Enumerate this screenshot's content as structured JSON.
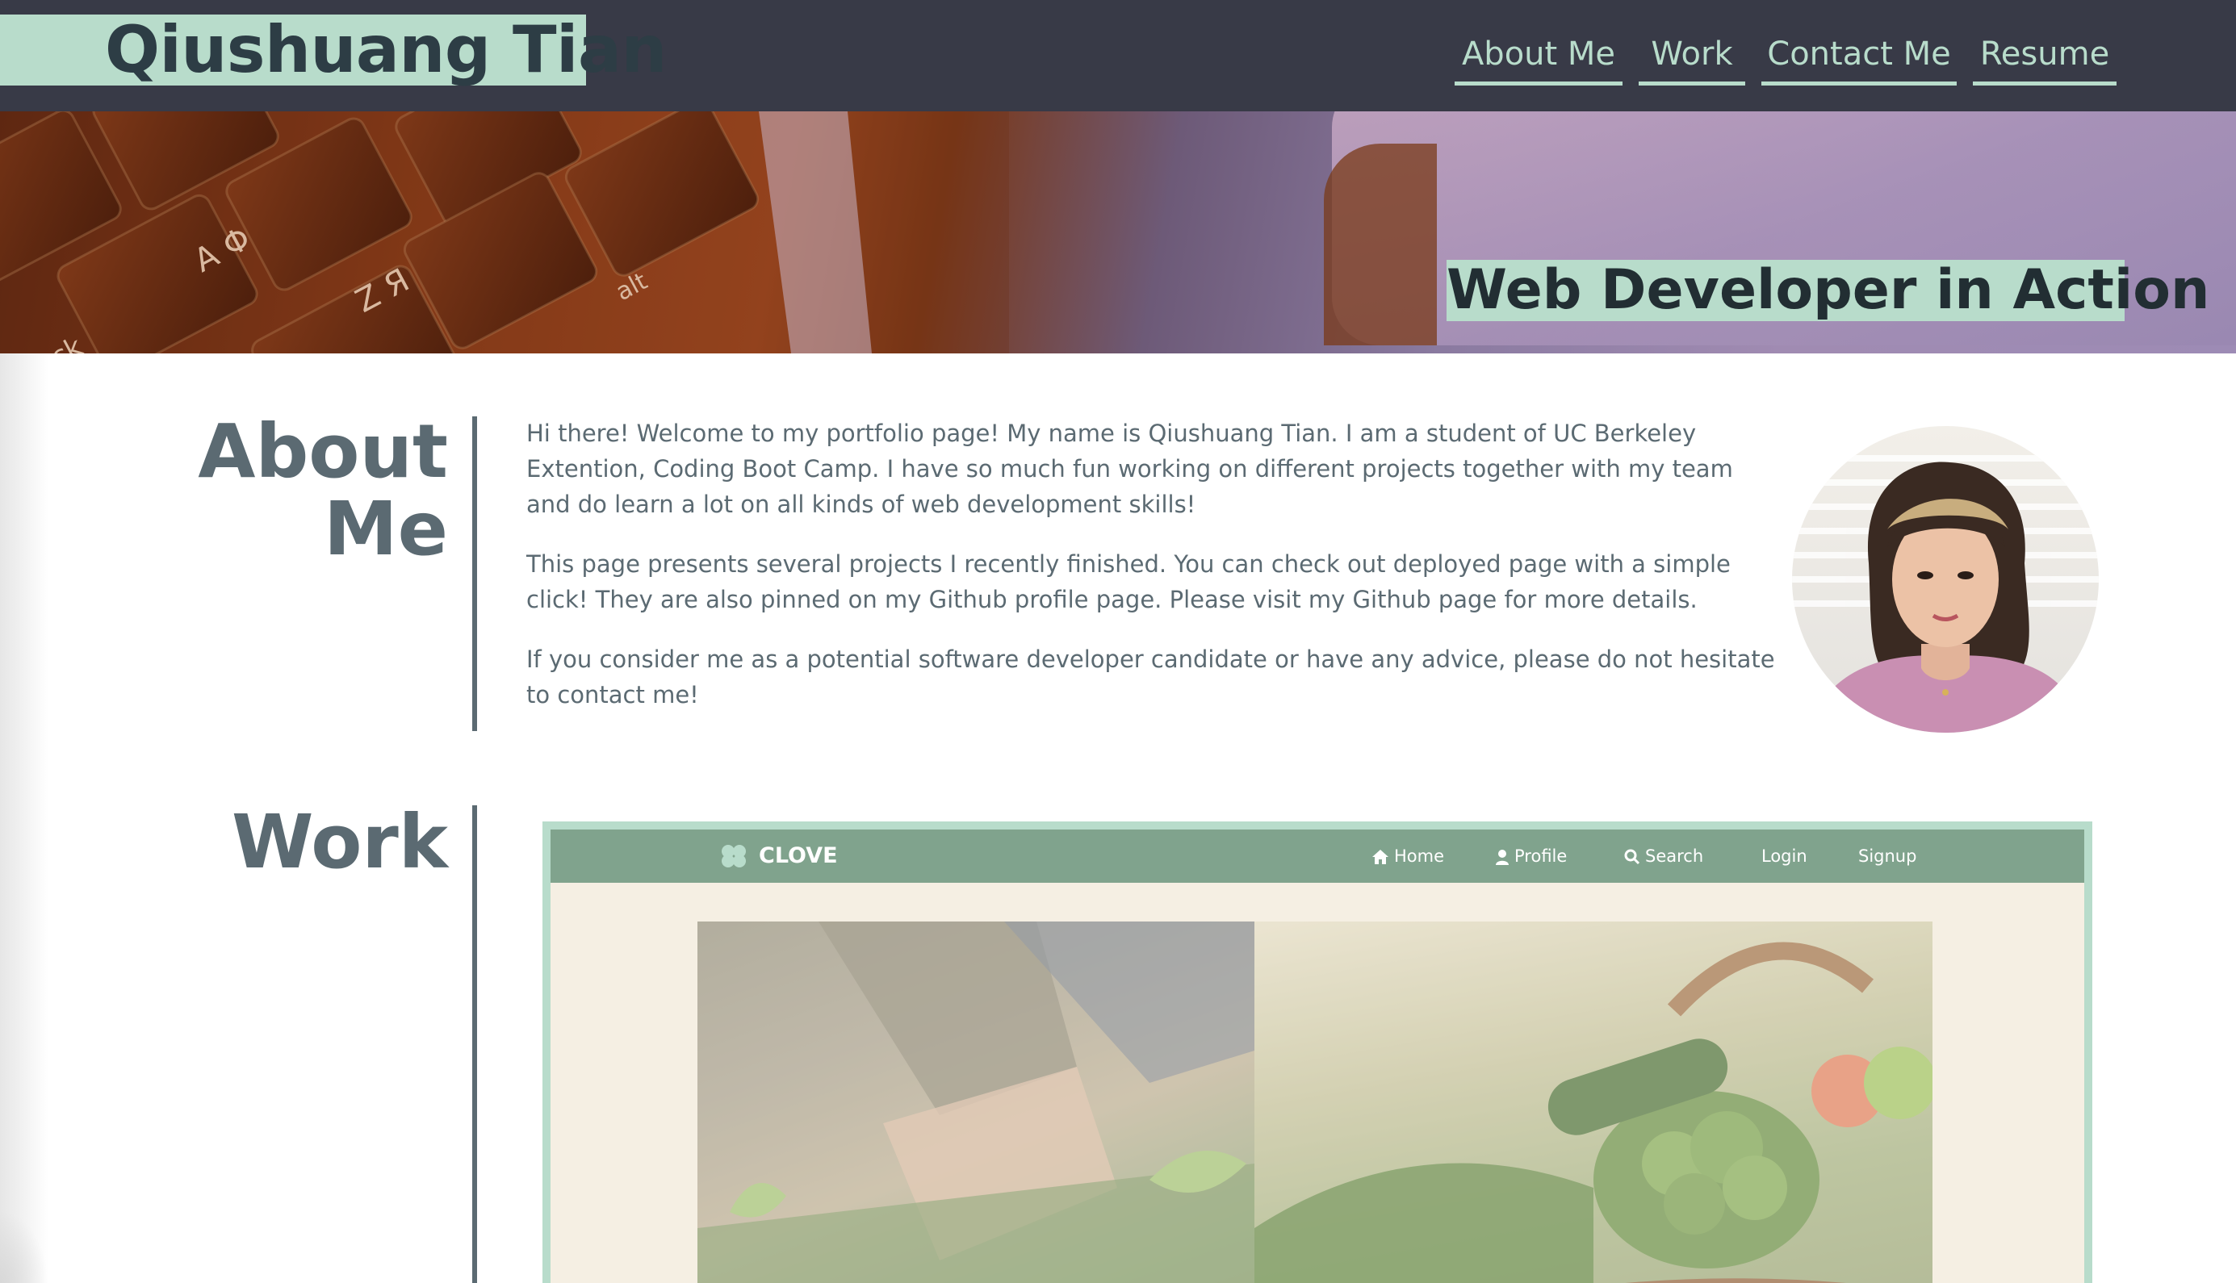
{
  "header": {
    "brand": "Qiushuang Tian",
    "nav": [
      "About Me",
      "Work",
      "Contact Me",
      "Resume"
    ]
  },
  "hero": {
    "title": "Web Developer in Action"
  },
  "about": {
    "title_line1": "About",
    "title_line2": "Me",
    "paragraphs": [
      "Hi there! Welcome to my portfolio page! My name is Qiushuang Tian. I am a student of UC Berkeley Extention, Coding Boot Camp. I have so much fun working on different projects together with my team and do learn a lot on all kinds of web development skills!",
      "This page presents several projects I recently finished. You can check out deployed page with a simple click! They are also pinned on my Github profile page. Please visit my Github page for more details.",
      "If you consider me as a potential software developer candidate or have any advice, please do not hesitate to contact me!"
    ]
  },
  "work": {
    "title": "Work",
    "preview": {
      "brand": "CLOVE",
      "nav": [
        "Home",
        "Profile",
        "Search",
        "Login",
        "Signup"
      ]
    }
  },
  "colors": {
    "header_bg": "#383a47",
    "accent_mint": "#b8dccb",
    "text_slate": "#5b6a72",
    "clove_green": "#80a38d",
    "clove_cream": "#f5efe3"
  },
  "icons": {
    "avatar": "portrait-photo",
    "home": "home-icon",
    "profile": "user-icon",
    "search": "search-icon",
    "clove": "clover-icon"
  }
}
